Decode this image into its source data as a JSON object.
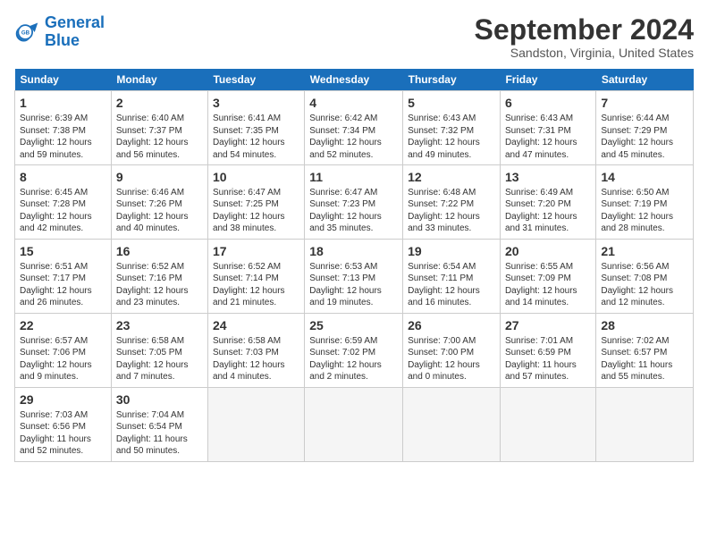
{
  "logo": {
    "line1": "General",
    "line2": "Blue"
  },
  "title": "September 2024",
  "subtitle": "Sandston, Virginia, United States",
  "headers": [
    "Sunday",
    "Monday",
    "Tuesday",
    "Wednesday",
    "Thursday",
    "Friday",
    "Saturday"
  ],
  "weeks": [
    [
      {
        "day": "1",
        "lines": [
          "Sunrise: 6:39 AM",
          "Sunset: 7:38 PM",
          "Daylight: 12 hours",
          "and 59 minutes."
        ]
      },
      {
        "day": "2",
        "lines": [
          "Sunrise: 6:40 AM",
          "Sunset: 7:37 PM",
          "Daylight: 12 hours",
          "and 56 minutes."
        ]
      },
      {
        "day": "3",
        "lines": [
          "Sunrise: 6:41 AM",
          "Sunset: 7:35 PM",
          "Daylight: 12 hours",
          "and 54 minutes."
        ]
      },
      {
        "day": "4",
        "lines": [
          "Sunrise: 6:42 AM",
          "Sunset: 7:34 PM",
          "Daylight: 12 hours",
          "and 52 minutes."
        ]
      },
      {
        "day": "5",
        "lines": [
          "Sunrise: 6:43 AM",
          "Sunset: 7:32 PM",
          "Daylight: 12 hours",
          "and 49 minutes."
        ]
      },
      {
        "day": "6",
        "lines": [
          "Sunrise: 6:43 AM",
          "Sunset: 7:31 PM",
          "Daylight: 12 hours",
          "and 47 minutes."
        ]
      },
      {
        "day": "7",
        "lines": [
          "Sunrise: 6:44 AM",
          "Sunset: 7:29 PM",
          "Daylight: 12 hours",
          "and 45 minutes."
        ]
      }
    ],
    [
      {
        "day": "8",
        "lines": [
          "Sunrise: 6:45 AM",
          "Sunset: 7:28 PM",
          "Daylight: 12 hours",
          "and 42 minutes."
        ]
      },
      {
        "day": "9",
        "lines": [
          "Sunrise: 6:46 AM",
          "Sunset: 7:26 PM",
          "Daylight: 12 hours",
          "and 40 minutes."
        ]
      },
      {
        "day": "10",
        "lines": [
          "Sunrise: 6:47 AM",
          "Sunset: 7:25 PM",
          "Daylight: 12 hours",
          "and 38 minutes."
        ]
      },
      {
        "day": "11",
        "lines": [
          "Sunrise: 6:47 AM",
          "Sunset: 7:23 PM",
          "Daylight: 12 hours",
          "and 35 minutes."
        ]
      },
      {
        "day": "12",
        "lines": [
          "Sunrise: 6:48 AM",
          "Sunset: 7:22 PM",
          "Daylight: 12 hours",
          "and 33 minutes."
        ]
      },
      {
        "day": "13",
        "lines": [
          "Sunrise: 6:49 AM",
          "Sunset: 7:20 PM",
          "Daylight: 12 hours",
          "and 31 minutes."
        ]
      },
      {
        "day": "14",
        "lines": [
          "Sunrise: 6:50 AM",
          "Sunset: 7:19 PM",
          "Daylight: 12 hours",
          "and 28 minutes."
        ]
      }
    ],
    [
      {
        "day": "15",
        "lines": [
          "Sunrise: 6:51 AM",
          "Sunset: 7:17 PM",
          "Daylight: 12 hours",
          "and 26 minutes."
        ]
      },
      {
        "day": "16",
        "lines": [
          "Sunrise: 6:52 AM",
          "Sunset: 7:16 PM",
          "Daylight: 12 hours",
          "and 23 minutes."
        ]
      },
      {
        "day": "17",
        "lines": [
          "Sunrise: 6:52 AM",
          "Sunset: 7:14 PM",
          "Daylight: 12 hours",
          "and 21 minutes."
        ]
      },
      {
        "day": "18",
        "lines": [
          "Sunrise: 6:53 AM",
          "Sunset: 7:13 PM",
          "Daylight: 12 hours",
          "and 19 minutes."
        ]
      },
      {
        "day": "19",
        "lines": [
          "Sunrise: 6:54 AM",
          "Sunset: 7:11 PM",
          "Daylight: 12 hours",
          "and 16 minutes."
        ]
      },
      {
        "day": "20",
        "lines": [
          "Sunrise: 6:55 AM",
          "Sunset: 7:09 PM",
          "Daylight: 12 hours",
          "and 14 minutes."
        ]
      },
      {
        "day": "21",
        "lines": [
          "Sunrise: 6:56 AM",
          "Sunset: 7:08 PM",
          "Daylight: 12 hours",
          "and 12 minutes."
        ]
      }
    ],
    [
      {
        "day": "22",
        "lines": [
          "Sunrise: 6:57 AM",
          "Sunset: 7:06 PM",
          "Daylight: 12 hours",
          "and 9 minutes."
        ]
      },
      {
        "day": "23",
        "lines": [
          "Sunrise: 6:58 AM",
          "Sunset: 7:05 PM",
          "Daylight: 12 hours",
          "and 7 minutes."
        ]
      },
      {
        "day": "24",
        "lines": [
          "Sunrise: 6:58 AM",
          "Sunset: 7:03 PM",
          "Daylight: 12 hours",
          "and 4 minutes."
        ]
      },
      {
        "day": "25",
        "lines": [
          "Sunrise: 6:59 AM",
          "Sunset: 7:02 PM",
          "Daylight: 12 hours",
          "and 2 minutes."
        ]
      },
      {
        "day": "26",
        "lines": [
          "Sunrise: 7:00 AM",
          "Sunset: 7:00 PM",
          "Daylight: 12 hours",
          "and 0 minutes."
        ]
      },
      {
        "day": "27",
        "lines": [
          "Sunrise: 7:01 AM",
          "Sunset: 6:59 PM",
          "Daylight: 11 hours",
          "and 57 minutes."
        ]
      },
      {
        "day": "28",
        "lines": [
          "Sunrise: 7:02 AM",
          "Sunset: 6:57 PM",
          "Daylight: 11 hours",
          "and 55 minutes."
        ]
      }
    ],
    [
      {
        "day": "29",
        "lines": [
          "Sunrise: 7:03 AM",
          "Sunset: 6:56 PM",
          "Daylight: 11 hours",
          "and 52 minutes."
        ]
      },
      {
        "day": "30",
        "lines": [
          "Sunrise: 7:04 AM",
          "Sunset: 6:54 PM",
          "Daylight: 11 hours",
          "and 50 minutes."
        ]
      },
      {
        "day": "",
        "lines": []
      },
      {
        "day": "",
        "lines": []
      },
      {
        "day": "",
        "lines": []
      },
      {
        "day": "",
        "lines": []
      },
      {
        "day": "",
        "lines": []
      }
    ]
  ]
}
